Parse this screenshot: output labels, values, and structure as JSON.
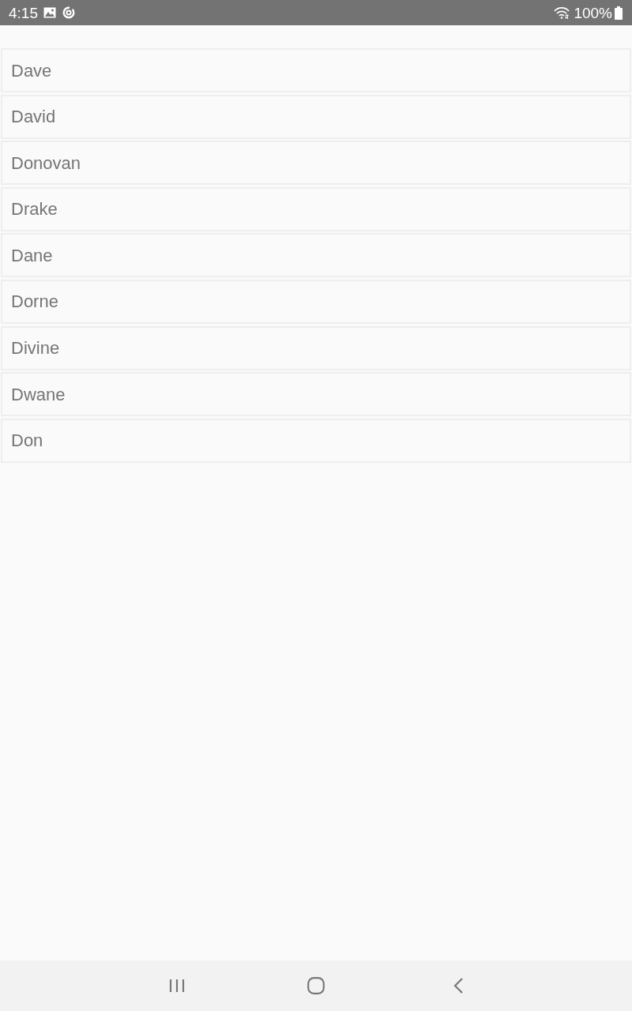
{
  "status_bar": {
    "time": "4:15",
    "battery": "100%"
  },
  "list": {
    "items": [
      {
        "label": "Dave"
      },
      {
        "label": "David"
      },
      {
        "label": "Donovan"
      },
      {
        "label": "Drake"
      },
      {
        "label": "Dane"
      },
      {
        "label": "Dorne"
      },
      {
        "label": "Divine"
      },
      {
        "label": "Dwane"
      },
      {
        "label": "Don"
      }
    ]
  }
}
